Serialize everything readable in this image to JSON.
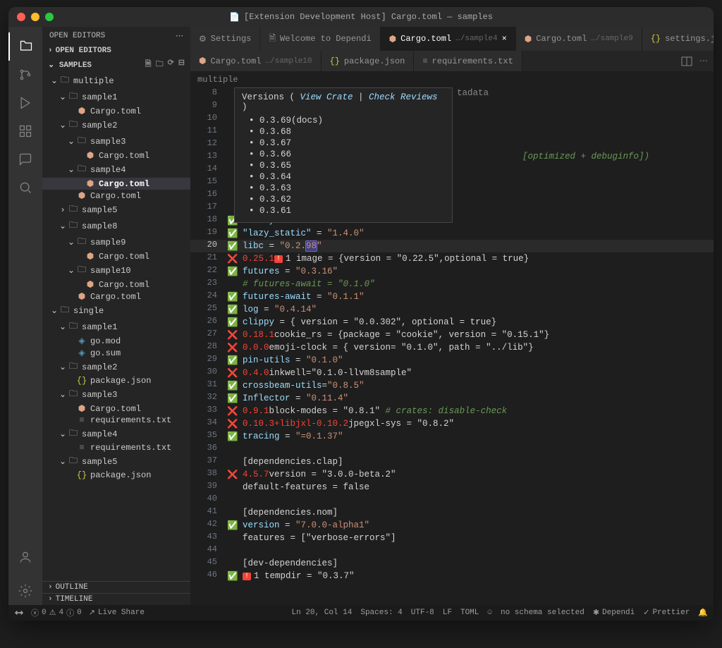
{
  "title": "[Extension Development Host] Cargo.toml — samples",
  "sidebar": {
    "header": "OPEN EDITORS",
    "sections": {
      "open_editors": "OPEN EDITORS",
      "samples": "SAMPLES",
      "outline": "OUTLINE",
      "timeline": "TIMELINE"
    },
    "tree": [
      {
        "type": "folder",
        "name": "multiple",
        "indent": 0,
        "open": true
      },
      {
        "type": "folder",
        "name": "sample1",
        "indent": 1,
        "open": true
      },
      {
        "type": "file",
        "name": "Cargo.toml",
        "indent": 2,
        "icon": "cargo"
      },
      {
        "type": "folder",
        "name": "sample2",
        "indent": 1,
        "open": true
      },
      {
        "type": "folder",
        "name": "sample3",
        "indent": 2,
        "open": true
      },
      {
        "type": "file",
        "name": "Cargo.toml",
        "indent": 3,
        "icon": "cargo"
      },
      {
        "type": "folder",
        "name": "sample4",
        "indent": 2,
        "open": true
      },
      {
        "type": "file",
        "name": "Cargo.toml",
        "indent": 3,
        "icon": "cargo",
        "active": true,
        "bold": true
      },
      {
        "type": "file",
        "name": "Cargo.toml",
        "indent": 2,
        "icon": "cargo"
      },
      {
        "type": "folder",
        "name": "sample5",
        "indent": 1,
        "open": false
      },
      {
        "type": "folder",
        "name": "sample8",
        "indent": 1,
        "open": true
      },
      {
        "type": "folder",
        "name": "sample9",
        "indent": 2,
        "open": true
      },
      {
        "type": "file",
        "name": "Cargo.toml",
        "indent": 3,
        "icon": "cargo"
      },
      {
        "type": "folder",
        "name": "sample10",
        "indent": 2,
        "open": true
      },
      {
        "type": "file",
        "name": "Cargo.toml",
        "indent": 3,
        "icon": "cargo"
      },
      {
        "type": "file",
        "name": "Cargo.toml",
        "indent": 2,
        "icon": "cargo"
      },
      {
        "type": "folder",
        "name": "single",
        "indent": 0,
        "open": true
      },
      {
        "type": "folder",
        "name": "sample1",
        "indent": 1,
        "open": true
      },
      {
        "type": "file",
        "name": "go.mod",
        "indent": 2,
        "icon": "go"
      },
      {
        "type": "file",
        "name": "go.sum",
        "indent": 2,
        "icon": "go"
      },
      {
        "type": "folder",
        "name": "sample2",
        "indent": 1,
        "open": true
      },
      {
        "type": "file",
        "name": "package.json",
        "indent": 2,
        "icon": "json"
      },
      {
        "type": "folder",
        "name": "sample3",
        "indent": 1,
        "open": true
      },
      {
        "type": "file",
        "name": "Cargo.toml",
        "indent": 2,
        "icon": "cargo"
      },
      {
        "type": "file",
        "name": "requirements.txt",
        "indent": 2,
        "icon": "txt"
      },
      {
        "type": "folder",
        "name": "sample4",
        "indent": 1,
        "open": true
      },
      {
        "type": "file",
        "name": "requirements.txt",
        "indent": 2,
        "icon": "txt"
      },
      {
        "type": "folder",
        "name": "sample5",
        "indent": 1,
        "open": true
      },
      {
        "type": "file",
        "name": "package.json",
        "indent": 2,
        "icon": "json"
      }
    ]
  },
  "tabs_row1": [
    {
      "icon": "gear",
      "label": "Settings"
    },
    {
      "icon": "file",
      "label": "Welcome to Dependi"
    },
    {
      "icon": "cargo",
      "label": "Cargo.toml",
      "path": "…/sample4",
      "active": true,
      "close": true
    },
    {
      "icon": "cargo",
      "label": "Cargo.toml",
      "path": "…/sample9"
    },
    {
      "icon": "json",
      "label": "settings.json"
    }
  ],
  "tabs_row2": [
    {
      "icon": "cargo",
      "label": "Cargo.toml",
      "path": "…/sample10"
    },
    {
      "icon": "json",
      "label": "package.json"
    },
    {
      "icon": "txt",
      "label": "requirements.txt"
    }
  ],
  "breadcrumb": "multiple",
  "breadcrumb_tail": "tadata",
  "hover": {
    "title_prefix": "Versions ( ",
    "link1": "View Crate",
    "sep": " | ",
    "link2": "Check Reviews",
    "title_suffix": " )",
    "items": [
      "0.3.69(docs)",
      "0.3.68",
      "0.3.67",
      "0.3.66",
      "0.3.65",
      "0.3.64",
      "0.3.63",
      "0.3.62",
      "0.3.61"
    ]
  },
  "code": {
    "l8": "8",
    "l9": "9",
    "l10": "10",
    "l11": "11",
    "l12": "12",
    "l13_hint": "[optimized + debuginfo])",
    "l14": "14",
    "l15": "15",
    "l16": "16",
    "l17": "17",
    "l18": {
      "k": "web-sys",
      "v": "\"0.3.51\""
    },
    "l19": {
      "k": "\"lazy_static\"",
      "v": "\"1.4.0\""
    },
    "l20": {
      "k": "libc",
      "pre": "\"0.2.",
      "hl": "98",
      "post": "\""
    },
    "l21": {
      "ver": "0.25.1",
      "warn": "1",
      "txt": "image = {version = \"0.22.5\",optional = true}"
    },
    "l22": {
      "k": "futures",
      "v": "\"0.3.16\""
    },
    "l23": "# futures-await = \"0.1.0\"",
    "l24": {
      "k": "futures-await",
      "v": "\"0.1.1\""
    },
    "l25": {
      "k": "log",
      "v": "\"0.4.14\""
    },
    "l26": {
      "k": "clippy",
      "v": "{ version = \"0.0.302\", optional = true}"
    },
    "l27": {
      "ver": "0.18.1",
      "txt": "cookie_rs = {package = \"cookie\", version = \"0.15.1\"}"
    },
    "l28": {
      "ver": "0.0.0",
      "txt": "emoji-clock = { version= \"0.1.0\", path = \"../lib\"}"
    },
    "l29": {
      "k": "pin-utils",
      "v": "\"0.1.0\""
    },
    "l30": {
      "ver": "0.4.0",
      "txt": "inkwell=\"0.1.0-llvm8sample\""
    },
    "l31": {
      "k": "crossbeam-utils",
      "v": "\"0.8.5\""
    },
    "l32": {
      "k": "Inflector",
      "v": "\"0.11.4\""
    },
    "l33": {
      "ver": "0.9.1",
      "txt": "block-modes = \"0.8.1\"",
      "hint": " # crates: disable-check"
    },
    "l34": {
      "ver": "0.10.3+libjxl-0.10.2",
      "txt": "jpegxl-sys = \"0.8.2\""
    },
    "l35": {
      "k": "tracing",
      "v": "\"=0.1.37\""
    },
    "l37": "[dependencies.clap]",
    "l38": {
      "ver": "4.5.7",
      "txt": "version = \"3.0.0-beta.2\""
    },
    "l39": "default-features = false",
    "l41": "[dependencies.nom]",
    "l42": {
      "k": "version",
      "v": "\"7.0.0-alpha1\""
    },
    "l43": "features = [\"verbose-errors\"]",
    "l45": "[dev-dependencies]",
    "l46": {
      "warn": "1",
      "txt": "tempdir = \"0.3.7\""
    }
  },
  "status": {
    "errors": "0",
    "warnings": "4",
    "info": "0",
    "liveshare": "Live Share",
    "pos": "Ln 20, Col 14",
    "spaces": "Spaces: 4",
    "enc": "UTF-8",
    "eol": "LF",
    "lang": "TOML",
    "schema": "no schema selected",
    "dependi": "Dependi",
    "prettier": "Prettier"
  }
}
